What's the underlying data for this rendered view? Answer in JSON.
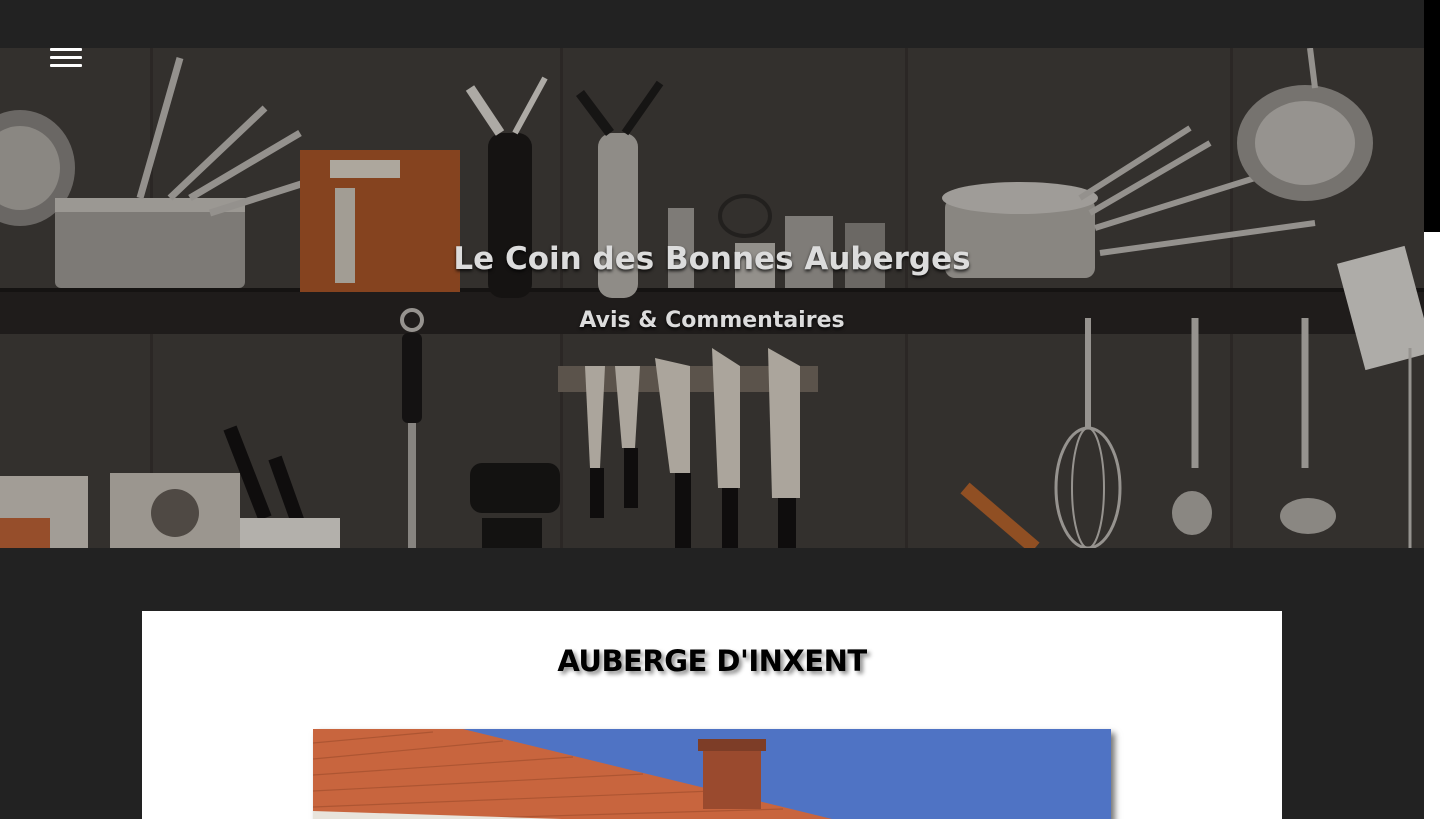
{
  "header": {
    "site_title": "Le Coin des Bonnes Auberges",
    "subtitle": "Avis & Commentaires",
    "menu_icon": "hamburger-menu-icon"
  },
  "article": {
    "title": "AUBERGE D'INXENT"
  },
  "colors": {
    "background": "#222222",
    "card": "#ffffff",
    "title_text": "#dcdcdc",
    "sky": "#4f73c4",
    "roof": "#c8653e"
  }
}
